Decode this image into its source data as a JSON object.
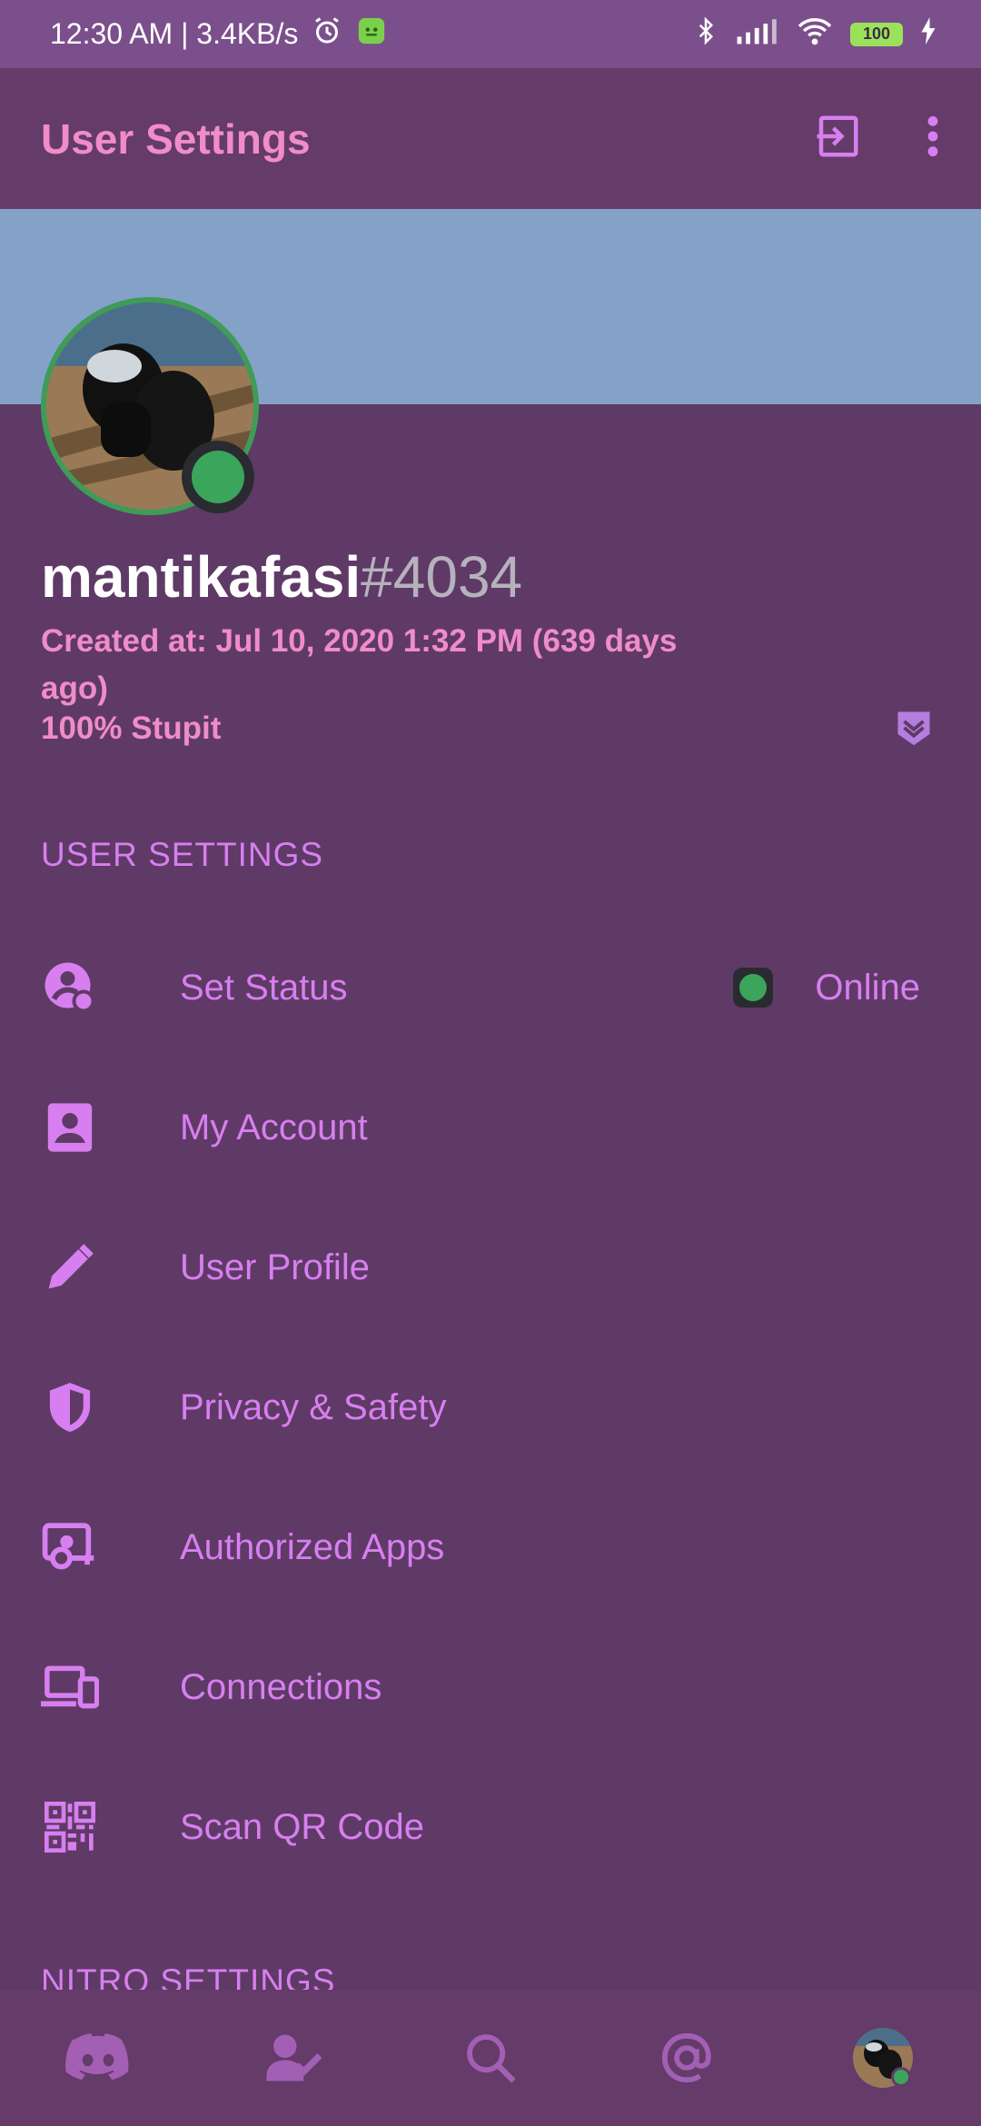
{
  "status_bar": {
    "time": "12:30 AM | 3.4KB/s",
    "battery": "100"
  },
  "header": {
    "title": "User Settings"
  },
  "profile": {
    "username": "mantikafasi",
    "discriminator": "#4034",
    "created": "Created at: Jul 10, 2020 1:32 PM (639 days ago)",
    "about": "100% Stupit"
  },
  "user_settings": {
    "section_title": "USER SETTINGS",
    "items": [
      {
        "label": "Set Status",
        "icon": "status-icon",
        "value": "Online"
      },
      {
        "label": "My Account",
        "icon": "account-icon"
      },
      {
        "label": "User Profile",
        "icon": "pencil-icon"
      },
      {
        "label": "Privacy & Safety",
        "icon": "shield-icon"
      },
      {
        "label": "Authorized Apps",
        "icon": "authorized-apps-icon"
      },
      {
        "label": "Connections",
        "icon": "devices-icon"
      },
      {
        "label": "Scan QR Code",
        "icon": "qr-code-icon"
      }
    ]
  },
  "nitro_settings": {
    "section_title": "NITRO SETTINGS"
  },
  "bottom_nav": {
    "items": [
      "discord-home-icon",
      "friends-icon",
      "search-icon",
      "mentions-icon",
      "profile-avatar"
    ]
  },
  "colors": {
    "background": "#5f3a66",
    "accent_pink": "#f08cc8",
    "accent_purple": "#d77ff0",
    "banner": "#84a2c8",
    "online_green": "#3ba55c"
  }
}
